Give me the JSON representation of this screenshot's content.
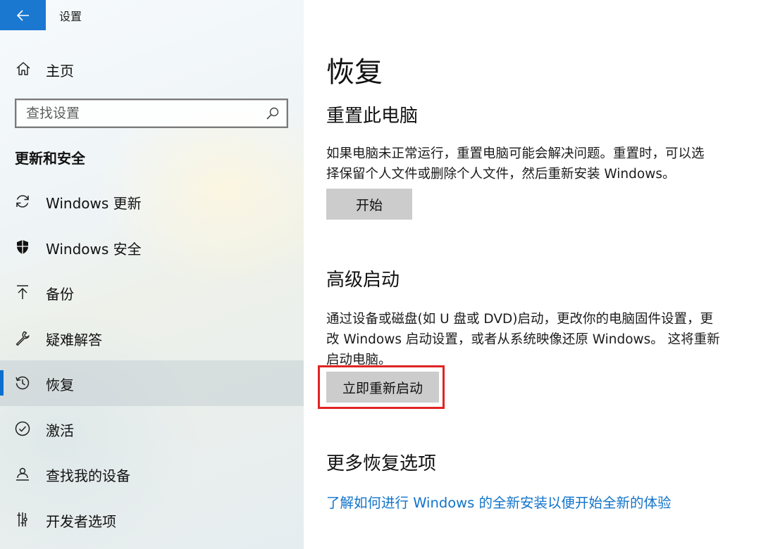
{
  "window": {
    "title": "设置",
    "back_icon": "arrow-left-icon",
    "accent_color": "#1a78d0"
  },
  "sidebar": {
    "home": {
      "label": "主页",
      "icon": "home-icon"
    },
    "search": {
      "placeholder": "查找设置",
      "icon": "search-icon"
    },
    "section_title": "更新和安全",
    "items": [
      {
        "label": "Windows 更新",
        "icon": "sync-icon",
        "active": false
      },
      {
        "label": "Windows 安全",
        "icon": "shield-icon",
        "active": false
      },
      {
        "label": "备份",
        "icon": "upload-arrow-icon",
        "active": false
      },
      {
        "label": "疑难解答",
        "icon": "wrench-icon",
        "active": false
      },
      {
        "label": "恢复",
        "icon": "history-icon",
        "active": true
      },
      {
        "label": "激活",
        "icon": "check-circle-icon",
        "active": false
      },
      {
        "label": "查找我的设备",
        "icon": "person-location-icon",
        "active": false
      },
      {
        "label": "开发者选项",
        "icon": "developer-tools-icon",
        "active": false
      }
    ]
  },
  "content": {
    "title": "恢复",
    "reset": {
      "heading": "重置此电脑",
      "description_line1": "如果电脑未正常运行，重置电脑可能会解决问题。重置时，可以选",
      "description_line2": "择保留个人文件或删除个人文件，然后重新安装 Windows。",
      "button_label": "开始"
    },
    "advanced": {
      "heading": "高级启动",
      "description_line1": "通过设备或磁盘(如 U 盘或 DVD)启动，更改你的电脑固件设置，更",
      "description_line2": "改 Windows 启动设置，或者从系统映像还原 Windows。 这将重新",
      "description_line3": "启动电脑。",
      "button_label": "立即重新启动",
      "highlight_color": "#e02424"
    },
    "more": {
      "heading": "更多恢复选项",
      "link_text": "了解如何进行 Windows 的全新安装以便开始全新的体验",
      "link_color": "#1173c9"
    }
  }
}
